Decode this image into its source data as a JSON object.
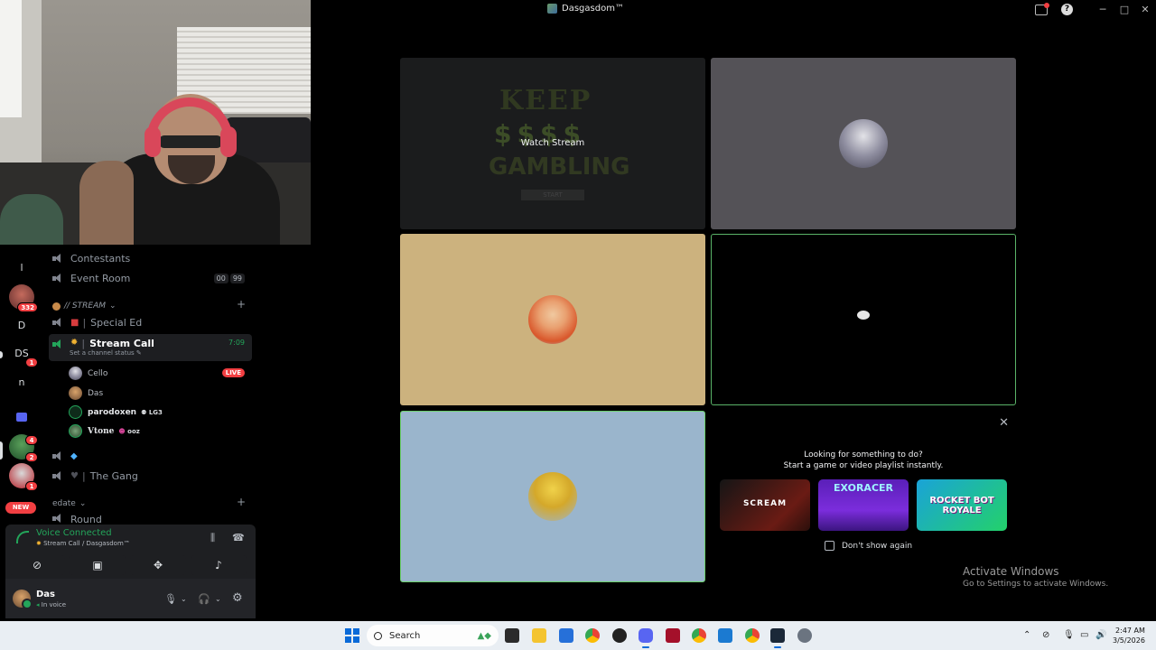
{
  "window": {
    "title": "Dasgasdom™"
  },
  "server_rail": {
    "items": [
      {
        "label": "l"
      },
      {
        "label": "D"
      },
      {
        "label": "DS"
      },
      {
        "label": "n"
      }
    ],
    "badges": [
      "332",
      "1",
      "4",
      "2",
      "1"
    ],
    "new_label": "NEW"
  },
  "channels": {
    "contestants": "Contestants",
    "event_room": "Event Room",
    "event_room_counts": [
      "00",
      "99"
    ],
    "stream_category": "// STREAM",
    "special_ed": "Special Ed",
    "stream_call": "Stream Call",
    "stream_call_time": "7:09",
    "stream_call_status": "Set a channel status",
    "members": [
      {
        "name": "Cello",
        "live": "LIVE"
      },
      {
        "name": "Das"
      },
      {
        "name": "parodoxen",
        "tag": "LG3"
      },
      {
        "name": "Vtone",
        "tag": "ooz"
      }
    ],
    "the_gang": "The Gang",
    "edate_category": "edate",
    "partial_channel": "Round"
  },
  "voice": {
    "status": "Voice Connected",
    "location": "Stream Call / Dasgasdom™"
  },
  "user": {
    "name": "Das",
    "status": "In voice"
  },
  "grid": {
    "watch_stream": "Watch Stream",
    "stream_art": {
      "line1": "KEEP",
      "line2": "$$$$",
      "line3": "GAMBLING",
      "button": "START"
    }
  },
  "activity": {
    "title_line1": "Looking for something to do?",
    "title_line2": "Start a game or video playlist instantly.",
    "games": [
      {
        "name": "SCREAM"
      },
      {
        "name": "EXORACER"
      },
      {
        "name": "ROCKET BOT ROYALE"
      }
    ],
    "dont_show": "Don't show again"
  },
  "activate_windows": {
    "line1": "Activate Windows",
    "line2": "Go to Settings to activate Windows."
  },
  "taskbar": {
    "search_placeholder": "Search",
    "time": "2:47 AM",
    "date": "3/5/2026"
  },
  "colors": {
    "accent_green": "#23a55a",
    "live_red": "#f23f42",
    "blurple": "#5865f2"
  }
}
